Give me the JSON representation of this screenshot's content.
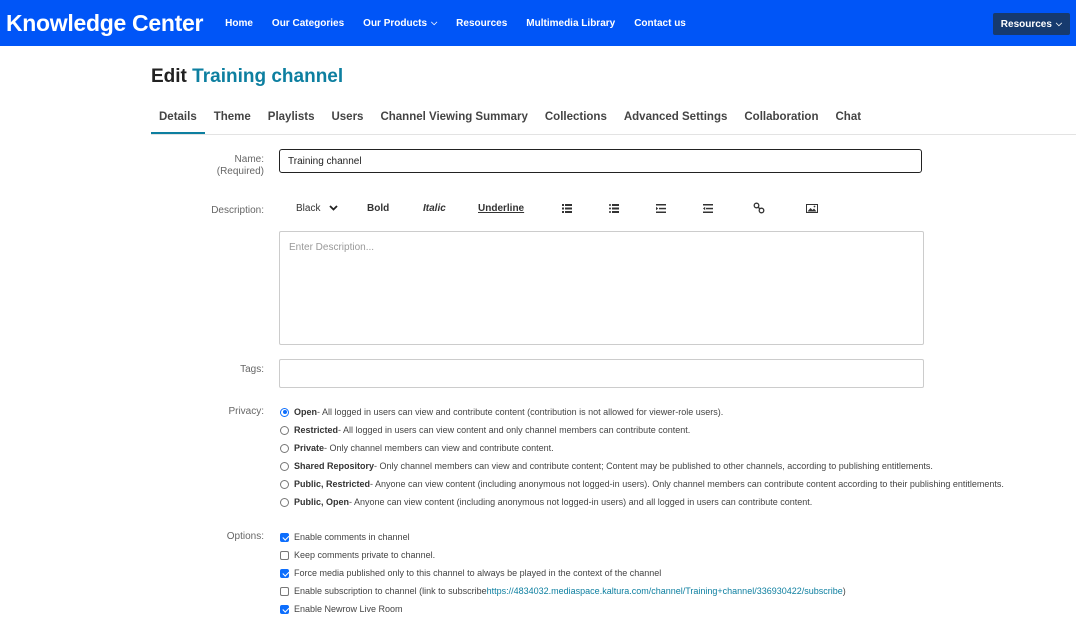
{
  "nav": {
    "brand": "Knowledge Center",
    "links": [
      "Home",
      "Our Categories",
      "Our Products",
      "Resources",
      "Multimedia Library",
      "Contact us"
    ],
    "resources_button": "Resources"
  },
  "page": {
    "title_prefix": "Edit",
    "channel_name": "Training channel"
  },
  "tabs": [
    "Details",
    "Theme",
    "Playlists",
    "Users",
    "Channel Viewing Summary",
    "Collections",
    "Advanced Settings",
    "Collaboration",
    "Chat"
  ],
  "active_tab": "Details",
  "form": {
    "name_label": "Name:",
    "name_required": "(Required)",
    "name_value": "Training channel",
    "description_label": "Description:",
    "toolbar": {
      "color": "Black",
      "bold": "Bold",
      "italic": "Italic",
      "underline": "Underline",
      "icons": [
        "ordered-list-icon",
        "unordered-list-icon",
        "indent-icon",
        "outdent-icon",
        "link-icon",
        "image-icon"
      ]
    },
    "description_placeholder": "Enter Description...",
    "tags_label": "Tags:",
    "privacy_label": "Privacy:",
    "privacy_options": [
      {
        "name": "Open",
        "desc": " - All logged in users can view and contribute content (contribution is not allowed for viewer-role users).",
        "selected": true
      },
      {
        "name": "Restricted",
        "desc": " - All logged in users can view content and only channel members can contribute content.",
        "selected": false
      },
      {
        "name": "Private",
        "desc": " - Only channel members can view and contribute content.",
        "selected": false
      },
      {
        "name": "Shared Repository",
        "desc": " - Only channel members can view and contribute content; Content may be published to other channels, according to publishing entitlements.",
        "selected": false
      },
      {
        "name": "Public, Restricted",
        "desc": " - Anyone can view content (including anonymous not logged-in users). Only channel members can contribute content according to their publishing entitlements.",
        "selected": false
      },
      {
        "name": "Public, Open",
        "desc": " - Anyone can view content (including anonymous not logged-in users) and all logged in users can contribute content.",
        "selected": false
      }
    ],
    "options_label": "Options:",
    "options": [
      {
        "text": "Enable comments in channel",
        "checked": true
      },
      {
        "text": "Keep comments private to channel.",
        "checked": false
      },
      {
        "text": "Force media published only to this channel to always be played in the context of the channel",
        "checked": true
      },
      {
        "text": "Enable subscription to channel (link to subscribe ",
        "link": "https://4834032.mediaspace.kaltura.com/channel/Training+channel/336930422/subscribe",
        "suffix": ")",
        "checked": false
      },
      {
        "text": "Enable Newrow Live Room",
        "checked": true
      }
    ]
  },
  "colors": {
    "nav_bg": "#0055f7",
    "accent": "#0d7fa0",
    "resources_btn_bg": "#163a6e",
    "control_blue": "#0d6efd"
  }
}
